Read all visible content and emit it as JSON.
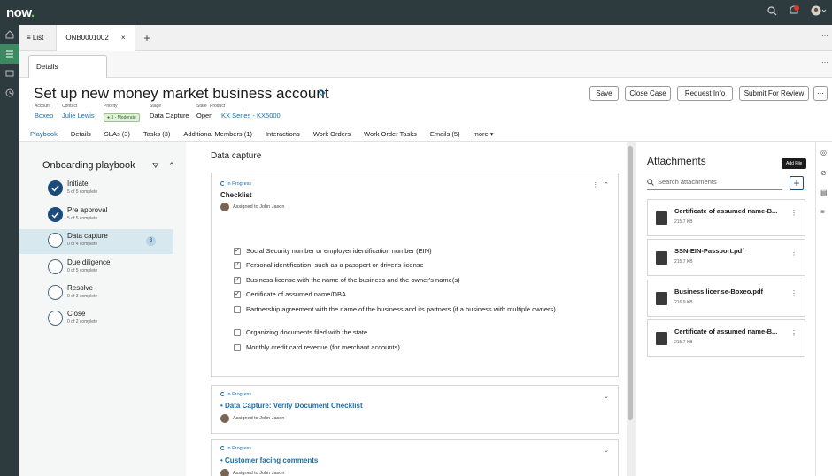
{
  "app": {
    "logo": "now",
    "logo_dot": "."
  },
  "tabbar": {
    "list_label": "≡ List",
    "record_tab": "ONB0001002",
    "close": "×",
    "plus": "+",
    "dots": "⋯"
  },
  "subbar": {
    "details_tab": "Details",
    "dots": "⋯"
  },
  "record": {
    "title": "Set up new money market business account",
    "meta": {
      "account_label": "Account",
      "account": "Boxeo",
      "contact_label": "Contact",
      "contact": "Julie Lewis",
      "priority_label": "Priority",
      "priority": "● 3 - Moderate",
      "stage_label": "Stage",
      "stage": "Data Capture",
      "state_label": "State",
      "state": "Open",
      "product_label": "Product",
      "product": "KX Series - KX5000"
    }
  },
  "actions": {
    "save": "Save",
    "close_case": "Close Case",
    "request_info": "Request Info",
    "submit": "Submit For Review",
    "more": "⋯"
  },
  "nav_tabs": [
    "Playbook",
    "Details",
    "SLAs (3)",
    "Tasks (3)",
    "Additional Members (1)",
    "Interactions",
    "Work Orders",
    "Work Order Tasks",
    "Emails (5)",
    "more ▾"
  ],
  "playbook": {
    "title": "Onboarding playbook",
    "filter": "⛛",
    "collapse": "⌃",
    "steps": [
      {
        "name": "Initiate",
        "sub": "5 of 5 complete",
        "status": "done"
      },
      {
        "name": "Pre approval",
        "sub": "5 of 5 complete",
        "status": "done"
      },
      {
        "name": "Data capture",
        "sub": "0 of 4 complete",
        "status": "current",
        "count": "3"
      },
      {
        "name": "Due diligence",
        "sub": "0 of 5 complete",
        "status": "todo"
      },
      {
        "name": "Resolve",
        "sub": "0 of 3 complete",
        "status": "todo"
      },
      {
        "name": "Close",
        "sub": "0 of 2 complete",
        "status": "todo"
      }
    ]
  },
  "data_capture": {
    "title": "Data capture",
    "checklist": {
      "status": "In Progress",
      "title": "Checklist",
      "assigned": "Assigned to John Jason",
      "items": [
        {
          "text": "Social Security number or employer identification number (EIN)",
          "checked": true
        },
        {
          "text": "Personal identification, such as a passport or driver's license",
          "checked": true
        },
        {
          "text": "Business license with the name of the business and the owner's name(s)",
          "checked": true
        },
        {
          "text": "Certificate of assumed name/DBA",
          "checked": true
        },
        {
          "text": "Partnership agreement with the name of the business and its partners (if a business with multiple owners)",
          "checked": false
        },
        {
          "text": "Organizing documents filed with the state",
          "checked": false
        },
        {
          "text": "Monthly credit card revenue (for merchant accounts)",
          "checked": false
        }
      ]
    },
    "tasks": [
      {
        "status": "In Progress",
        "title": "• Data Capture: Verify Document Checklist",
        "assigned": "Assigned to John Jason"
      },
      {
        "status": "In Progress",
        "title": "• Customer facing comments",
        "assigned": "Assigned to John Jason"
      }
    ]
  },
  "attachments": {
    "title": "Attachments",
    "search_placeholder": "Search attachments",
    "add_tooltip": "Add File",
    "add": "+",
    "files": [
      {
        "name": "Certificate of assumed name-B...",
        "size": "215.7 KB"
      },
      {
        "name": "SSN-EIN-Passport.pdf",
        "size": "215.7 KB"
      },
      {
        "name": "Business license-Boxeo.pdf",
        "size": "216.9 KB"
      },
      {
        "name": "Certificate of assumed name-B...",
        "size": "215.7 KB"
      }
    ]
  },
  "colors": {
    "topbar": "#2d3a3e",
    "accent": "#1b6fa7",
    "done": "#1b4b7a",
    "rail_active": "#3d8a62"
  }
}
